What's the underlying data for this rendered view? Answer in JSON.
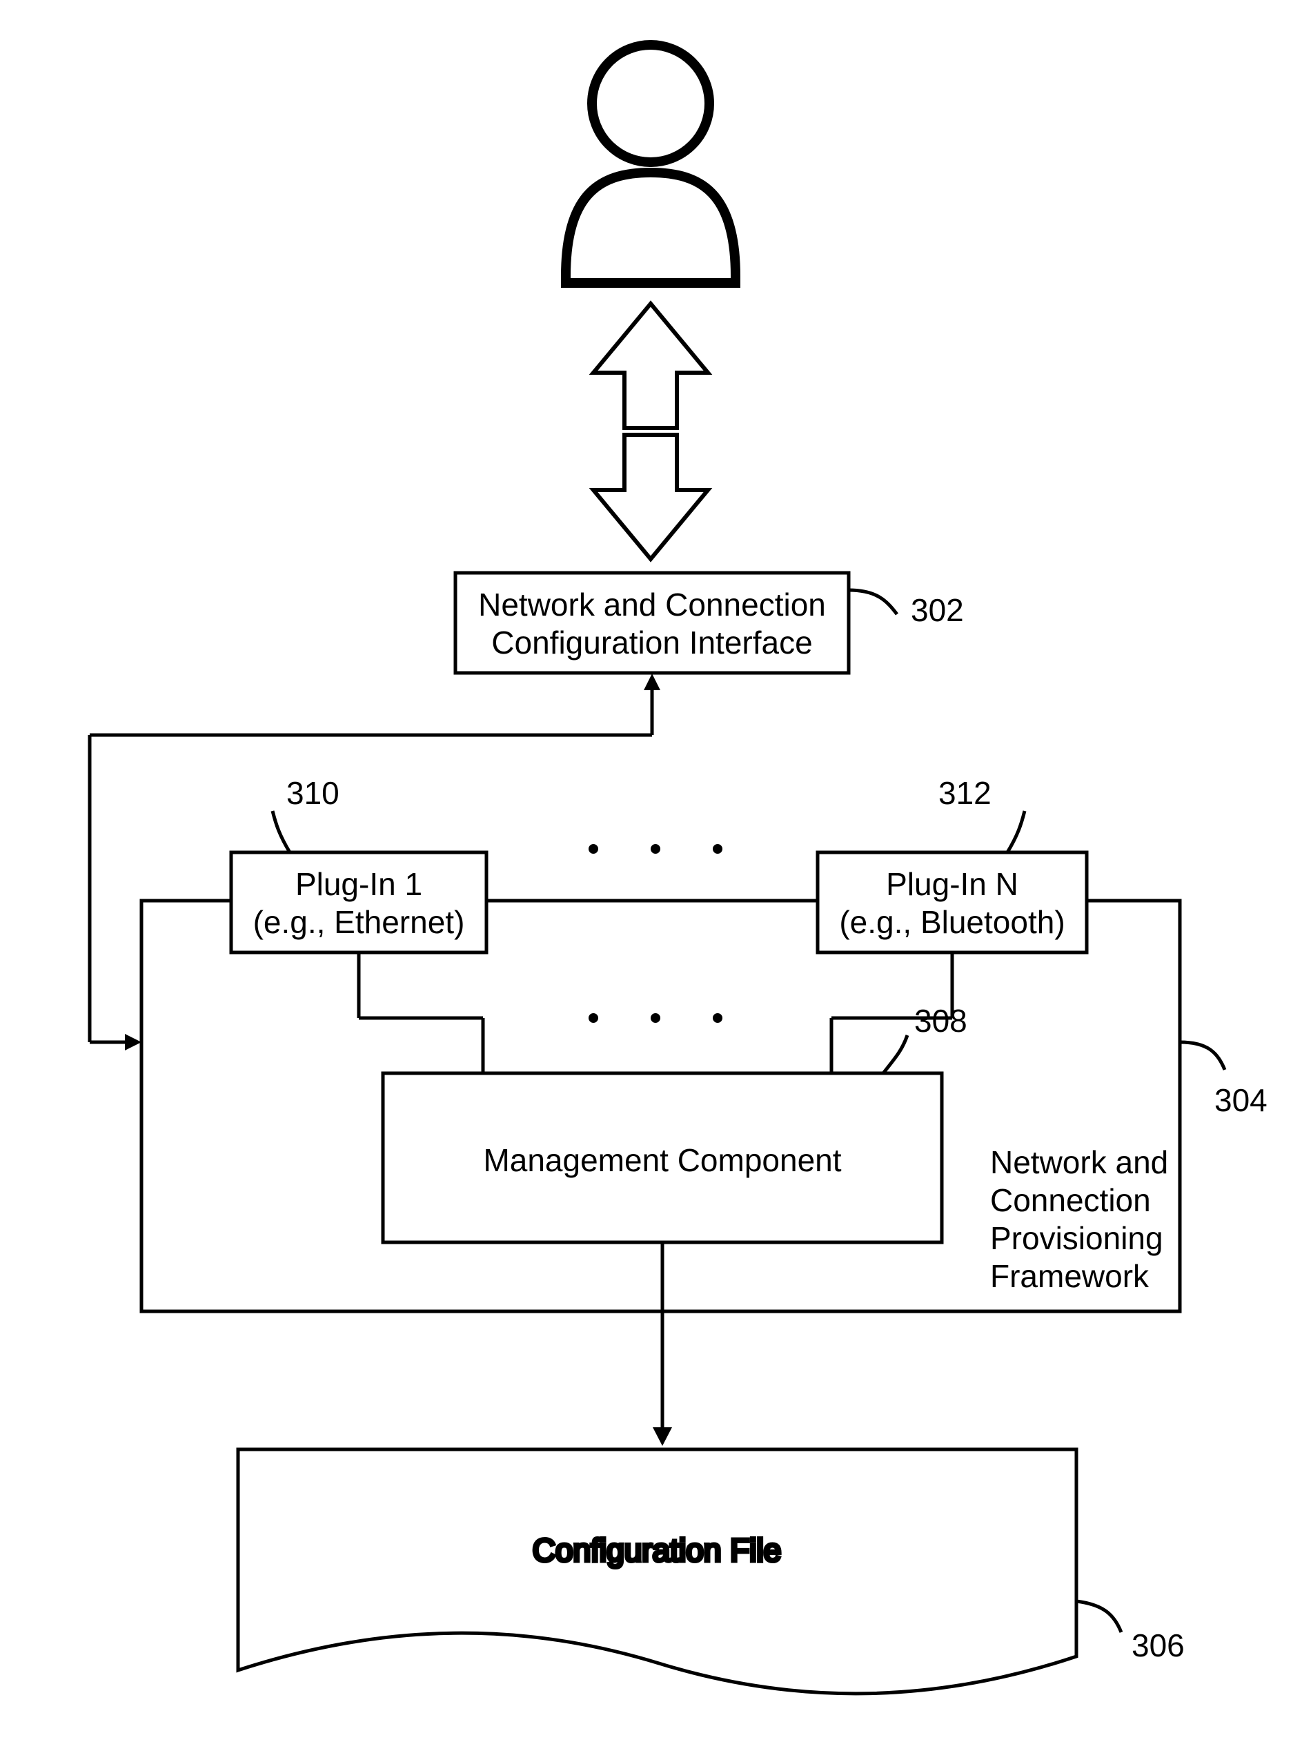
{
  "interface_box": {
    "line1": "Network and Connection",
    "line2": "Configuration Interface",
    "ref": "302"
  },
  "framework": {
    "ref": "304",
    "caption_line1": "Network and",
    "caption_line2": "Connection",
    "caption_line3": "Provisioning",
    "caption_line4": "Framework",
    "plugin1": {
      "line1": "Plug-In 1",
      "line2": "(e.g., Ethernet)",
      "ref": "310"
    },
    "pluginN": {
      "line1": "Plug-In N",
      "line2": "(e.g., Bluetooth)",
      "ref": "312"
    },
    "management": {
      "label": "Management Component",
      "ref": "308"
    }
  },
  "config_file": {
    "label": "Configuration File",
    "ref": "306"
  }
}
